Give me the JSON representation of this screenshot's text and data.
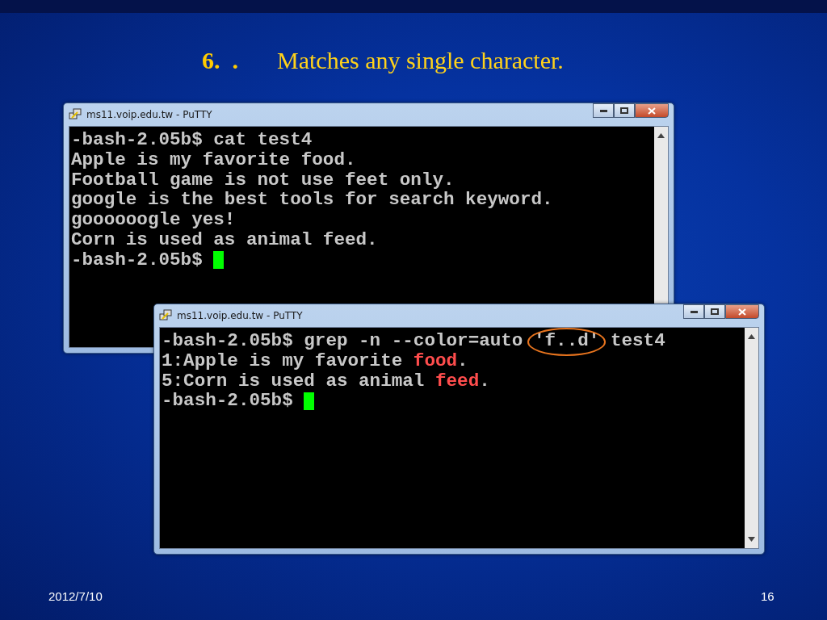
{
  "slide_title": {
    "number": "6.  .",
    "text": "Matches any single character."
  },
  "windows": [
    {
      "title": "ms11.voip.edu.tw - PuTTY",
      "lines": [
        {
          "cursor": false,
          "segments": [
            {
              "text": "-bash-2.05b$ cat test4",
              "highlight": false,
              "circled": false
            }
          ]
        },
        {
          "cursor": false,
          "segments": [
            {
              "text": "Apple is my favorite food.",
              "highlight": false,
              "circled": false
            }
          ]
        },
        {
          "cursor": false,
          "segments": [
            {
              "text": "Football game is not use feet only.",
              "highlight": false,
              "circled": false
            }
          ]
        },
        {
          "cursor": false,
          "segments": [
            {
              "text": "google is the best tools for search keyword.",
              "highlight": false,
              "circled": false
            }
          ]
        },
        {
          "cursor": false,
          "segments": [
            {
              "text": "goooooogle yes!",
              "highlight": false,
              "circled": false
            }
          ]
        },
        {
          "cursor": false,
          "segments": [
            {
              "text": "Corn is used as animal feed.",
              "highlight": false,
              "circled": false
            }
          ]
        },
        {
          "cursor": true,
          "segments": [
            {
              "text": "-bash-2.05b$ ",
              "highlight": false,
              "circled": false
            }
          ]
        }
      ]
    },
    {
      "title": "ms11.voip.edu.tw - PuTTY",
      "lines": [
        {
          "cursor": false,
          "segments": [
            {
              "text": "-bash-2.05b$ grep -n --color=auto ",
              "highlight": false,
              "circled": false
            },
            {
              "text": "'f..d'",
              "highlight": false,
              "circled": true
            },
            {
              "text": " test4",
              "highlight": false,
              "circled": false
            }
          ]
        },
        {
          "cursor": false,
          "segments": [
            {
              "text": "1:Apple is my favorite ",
              "highlight": false,
              "circled": false
            },
            {
              "text": "food",
              "highlight": true,
              "circled": false
            },
            {
              "text": ".",
              "highlight": false,
              "circled": false
            }
          ]
        },
        {
          "cursor": false,
          "segments": [
            {
              "text": "5:Corn is used as animal ",
              "highlight": false,
              "circled": false
            },
            {
              "text": "feed",
              "highlight": true,
              "circled": false
            },
            {
              "text": ".",
              "highlight": false,
              "circled": false
            }
          ]
        },
        {
          "cursor": true,
          "segments": [
            {
              "text": "-bash-2.05b$ ",
              "highlight": false,
              "circled": false
            }
          ]
        }
      ]
    }
  ],
  "footer": {
    "date": "2012/7/10",
    "page": "16"
  }
}
